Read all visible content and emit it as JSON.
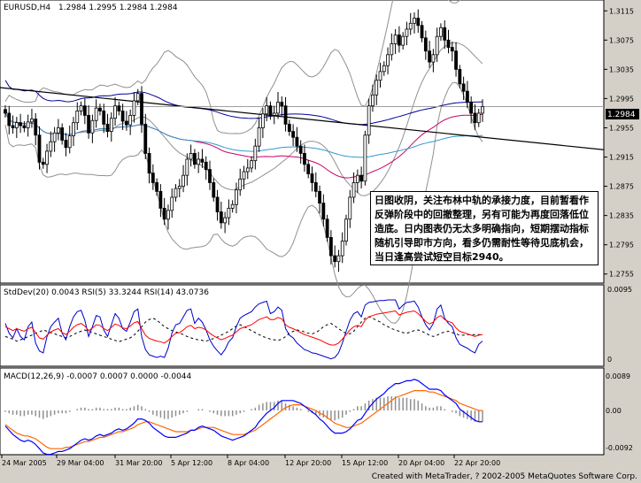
{
  "window": {
    "symbol_title": "EURUSD,H4",
    "ohlc": "1.2984 1.2995 1.2984 1.2984",
    "footer": "Created with MetaTrader, ? 2002-2005 MetaQuotes Software Corp."
  },
  "annotation": "日图收阴，关注布林中轨的承接力度，目前暂看作反弹阶段中的回撤整理，另有可能为再度回落低位造底。日内图表仍无太多明确指向，短期摆动指标随机引导即市方向，看多仍需耐性等待见底机会，当日逢高尝试短空目标2940。",
  "colors": {
    "background": "#d4d0c8",
    "panel": "#ffffff",
    "candle_up": "#ffffff",
    "candle_down": "#000000",
    "ma_red": "#cc0066",
    "ma_blue": "#000099",
    "ma_light_blue": "#3399cc",
    "bollinger": "#909090",
    "trendline": "#000000",
    "stddev": "#000000",
    "rsi5": "#0000cc",
    "rsi14": "#ff0000",
    "macd_hist": "#909090",
    "macd_signal": "#ff6600",
    "macd_main": "#0000ff"
  },
  "chart_data": [
    {
      "type": "candlestick",
      "title": "EURUSD,H4",
      "ylim": [
        1.2745,
        1.3125
      ],
      "yticks": [
        "1.3115",
        "1.3075",
        "1.3035",
        "1.2995",
        "1.2955",
        "1.2915",
        "1.2875",
        "1.2835",
        "1.2795",
        "1.2755"
      ],
      "current_price": "1.2984",
      "closes": [
        1.2975,
        1.2958,
        1.2955,
        1.2962,
        1.2958,
        1.2955,
        1.2963,
        1.2967,
        1.2945,
        1.2908,
        1.2905,
        1.2923,
        1.2936,
        1.2948,
        1.2955,
        1.2938,
        1.2928,
        1.2944,
        1.2962,
        1.2978,
        1.2985,
        1.2972,
        1.2948,
        1.2965,
        1.2982,
        1.2978,
        1.296,
        1.295,
        1.2968,
        1.2985,
        1.2978,
        1.2964,
        1.2959,
        1.2972,
        1.2992,
        1.3002,
        1.296,
        1.292,
        1.2893,
        1.288,
        1.2868,
        1.2845,
        1.283,
        1.2842,
        1.286,
        1.2872,
        1.2875,
        1.289,
        1.2912,
        1.292,
        1.2905,
        1.2912,
        1.2908,
        1.2898,
        1.288,
        1.286,
        1.284,
        1.2825,
        1.2832,
        1.2845,
        1.285,
        1.287,
        1.2885,
        1.2895,
        1.29,
        1.291,
        1.293,
        1.2955,
        1.2974,
        1.2985,
        1.2972,
        1.2975,
        1.299,
        1.2985,
        1.296,
        1.295,
        1.2942,
        1.293,
        1.292,
        1.2905,
        1.2892,
        1.288,
        1.2868,
        1.2852,
        1.283,
        1.2805,
        1.278,
        1.2772,
        1.278,
        1.28,
        1.283,
        1.286,
        1.288,
        1.289,
        1.2882,
        1.2945,
        1.2985,
        1.3,
        1.302,
        1.3032,
        1.304,
        1.3055,
        1.307,
        1.3082,
        1.3068,
        1.308,
        1.309,
        1.3098,
        1.3105,
        1.3095,
        1.3078,
        1.306,
        1.3045,
        1.3055,
        1.308,
        1.3092,
        1.3075,
        1.3065,
        1.306,
        1.3035,
        1.3015,
        1.3005,
        1.299,
        1.2975,
        1.2962,
        1.2975,
        1.2984
      ]
    },
    {
      "type": "line",
      "title": "StdDev(20) 0.0043  RSI(5) 33.3244  RSI(14) 43.0736",
      "yticks": [
        "0.0095",
        "0"
      ],
      "series": [
        {
          "name": "StdDev(20)",
          "values": [
            40,
            38,
            36,
            33,
            35,
            37,
            40,
            42,
            45,
            47,
            50,
            48,
            46,
            44,
            42,
            40,
            38,
            40,
            43,
            46,
            48,
            50,
            48,
            46,
            44,
            42,
            40,
            38,
            36,
            34,
            32,
            34,
            36,
            38,
            42,
            48,
            55,
            62,
            66,
            68,
            65,
            60,
            55,
            52,
            49,
            47,
            45,
            43,
            40,
            38,
            36,
            35,
            34,
            33,
            35,
            37,
            39,
            42,
            45,
            48,
            52,
            56,
            58,
            55,
            52,
            49,
            46,
            43,
            40,
            38,
            36,
            35,
            34,
            36,
            40,
            45,
            48,
            50,
            49,
            47,
            45,
            44,
            46,
            50,
            55,
            58,
            60,
            56,
            52,
            48,
            45,
            44,
            48,
            55,
            62,
            68,
            70,
            68,
            65,
            62,
            58,
            55,
            52,
            50,
            48,
            46,
            45,
            47,
            49,
            50,
            48,
            45,
            42,
            40,
            42,
            45,
            47,
            48,
            46,
            44,
            42,
            42,
            43,
            43,
            43,
            43,
            43
          ]
        },
        {
          "name": "RSI(5)",
          "values": [
            60,
            45,
            38,
            52,
            40,
            35,
            55,
            62,
            30,
            18,
            15,
            40,
            55,
            62,
            68,
            45,
            35,
            55,
            70,
            78,
            80,
            65,
            40,
            55,
            72,
            70,
            50,
            40,
            58,
            75,
            68,
            52,
            48,
            62,
            78,
            82,
            40,
            20,
            12,
            10,
            8,
            10,
            8,
            22,
            45,
            58,
            60,
            70,
            80,
            82,
            60,
            68,
            62,
            50,
            35,
            25,
            18,
            12,
            20,
            32,
            38,
            55,
            68,
            72,
            75,
            78,
            85,
            90,
            92,
            94,
            75,
            78,
            85,
            80,
            52,
            42,
            38,
            30,
            25,
            20,
            18,
            15,
            14,
            12,
            10,
            8,
            6,
            8,
            15,
            30,
            48,
            65,
            75,
            78,
            70,
            88,
            92,
            93,
            94,
            95,
            95,
            96,
            96,
            96,
            82,
            88,
            92,
            93,
            94,
            85,
            70,
            58,
            50,
            60,
            82,
            88,
            68,
            60,
            55,
            38,
            28,
            25,
            22,
            18,
            15,
            28,
            33
          ]
        },
        {
          "name": "RSI(14)",
          "values": [
            55,
            52,
            49,
            52,
            50,
            48,
            52,
            54,
            46,
            38,
            36,
            42,
            47,
            50,
            52,
            46,
            43,
            48,
            54,
            58,
            60,
            56,
            49,
            53,
            58,
            57,
            52,
            49,
            54,
            59,
            57,
            53,
            52,
            56,
            61,
            63,
            52,
            42,
            37,
            35,
            33,
            32,
            30,
            34,
            40,
            45,
            46,
            50,
            55,
            57,
            52,
            54,
            53,
            50,
            45,
            41,
            38,
            35,
            37,
            40,
            42,
            47,
            52,
            54,
            56,
            58,
            62,
            66,
            68,
            70,
            66,
            66,
            69,
            67,
            58,
            54,
            52,
            49,
            46,
            43,
            41,
            39,
            37,
            35,
            32,
            29,
            27,
            27,
            30,
            36,
            43,
            50,
            55,
            57,
            55,
            65,
            70,
            72,
            74,
            75,
            76,
            77,
            78,
            79,
            73,
            75,
            77,
            78,
            79,
            75,
            69,
            63,
            59,
            62,
            69,
            72,
            66,
            63,
            61,
            53,
            48,
            46,
            44,
            42,
            40,
            42,
            43
          ]
        }
      ]
    },
    {
      "type": "bar",
      "title": "MACD(12,26,9) -0.0007  0.0007  0.0000  -0.0044",
      "yticks": [
        "0.0089",
        "0.00",
        "-0.0092"
      ],
      "series": [
        {
          "name": "hist",
          "values": [
            -1,
            -2,
            -3,
            -3,
            -4,
            -4,
            -3,
            -3,
            -4,
            -5,
            -6,
            -5,
            -4,
            -3,
            -2,
            -2,
            -2,
            -1,
            0,
            1,
            2,
            2,
            1,
            1,
            2,
            2,
            1,
            1,
            1,
            2,
            2,
            1,
            1,
            2,
            3,
            4,
            3,
            1,
            -1,
            -3,
            -4,
            -5,
            -6,
            -6,
            -5,
            -4,
            -3,
            -2,
            -1,
            0,
            0,
            1,
            1,
            0,
            -1,
            -2,
            -3,
            -4,
            -4,
            -4,
            -4,
            -3,
            -2,
            -1,
            0,
            1,
            2,
            4,
            5,
            6,
            6,
            6,
            7,
            7,
            5,
            4,
            3,
            2,
            1,
            0,
            -1,
            -2,
            -3,
            -4,
            -5,
            -6,
            -7,
            -7,
            -6,
            -5,
            -3,
            -1,
            1,
            3,
            3,
            5,
            7,
            8,
            9,
            9,
            9,
            10,
            10,
            10,
            9,
            9,
            9,
            8,
            8,
            7,
            5,
            3,
            2,
            2,
            3,
            3,
            1,
            0,
            -1,
            -2,
            -4,
            -5,
            -6,
            -7,
            -8,
            -8,
            -8
          ]
        },
        {
          "name": "signal",
          "values": [
            -10,
            -12,
            -14,
            -16,
            -17,
            -18,
            -18,
            -19,
            -20,
            -22,
            -24,
            -26,
            -27,
            -27,
            -27,
            -27,
            -26,
            -26,
            -25,
            -24,
            -23,
            -22,
            -22,
            -21,
            -20,
            -19,
            -19,
            -18,
            -17,
            -16,
            -15,
            -15,
            -14,
            -13,
            -12,
            -10,
            -9,
            -8,
            -8,
            -9,
            -10,
            -11,
            -12,
            -13,
            -14,
            -15,
            -15,
            -15,
            -15,
            -14,
            -14,
            -13,
            -12,
            -12,
            -12,
            -12,
            -13,
            -14,
            -15,
            -16,
            -17,
            -17,
            -17,
            -17,
            -16,
            -15,
            -14,
            -12,
            -10,
            -8,
            -6,
            -4,
            -2,
            0,
            2,
            3,
            4,
            4,
            4,
            3,
            2,
            1,
            0,
            -2,
            -3,
            -5,
            -7,
            -9,
            -10,
            -11,
            -12,
            -12,
            -11,
            -10,
            -9,
            -7,
            -5,
            -3,
            -1,
            1,
            3,
            5,
            7,
            9,
            10,
            11,
            12,
            13,
            14,
            14,
            14,
            14,
            13,
            13,
            12,
            11,
            10,
            9,
            8,
            7,
            5,
            4,
            3,
            2,
            1,
            0,
            0
          ]
        },
        {
          "name": "main",
          "values": [
            -11,
            -14,
            -17,
            -19,
            -21,
            -22,
            -21,
            -22,
            -24,
            -27,
            -30,
            -31,
            -31,
            -30,
            -29,
            -29,
            -28,
            -27,
            -25,
            -23,
            -21,
            -20,
            -21,
            -20,
            -18,
            -17,
            -18,
            -17,
            -16,
            -14,
            -13,
            -14,
            -13,
            -11,
            -9,
            -6,
            -6,
            -7,
            -9,
            -12,
            -14,
            -16,
            -18,
            -19,
            -19,
            -19,
            -18,
            -17,
            -16,
            -14,
            -14,
            -12,
            -11,
            -12,
            -13,
            -14,
            -16,
            -18,
            -19,
            -20,
            -21,
            -20,
            -19,
            -18,
            -16,
            -14,
            -12,
            -8,
            -5,
            -2,
            0,
            2,
            5,
            7,
            7,
            7,
            7,
            6,
            5,
            3,
            1,
            -1,
            -3,
            -6,
            -8,
            -11,
            -14,
            -16,
            -16,
            -16,
            -15,
            -13,
            -10,
            -7,
            -6,
            -2,
            2,
            5,
            8,
            10,
            12,
            15,
            17,
            19,
            19,
            20,
            21,
            21,
            22,
            21,
            19,
            17,
            15,
            15,
            15,
            14,
            11,
            9,
            7,
            5,
            1,
            -1,
            -3,
            -5,
            -7,
            -8,
            -8
          ]
        }
      ]
    }
  ],
  "x_axis": {
    "ticks": [
      "24 Mar 2005",
      "29 Mar 04:00",
      "31 Mar 20:00",
      "5 Apr 12:00",
      "8 Apr 04:00",
      "12 Apr 20:00",
      "15 Apr 12:00",
      "20 Apr 04:00",
      "22 Apr 20:00"
    ]
  }
}
